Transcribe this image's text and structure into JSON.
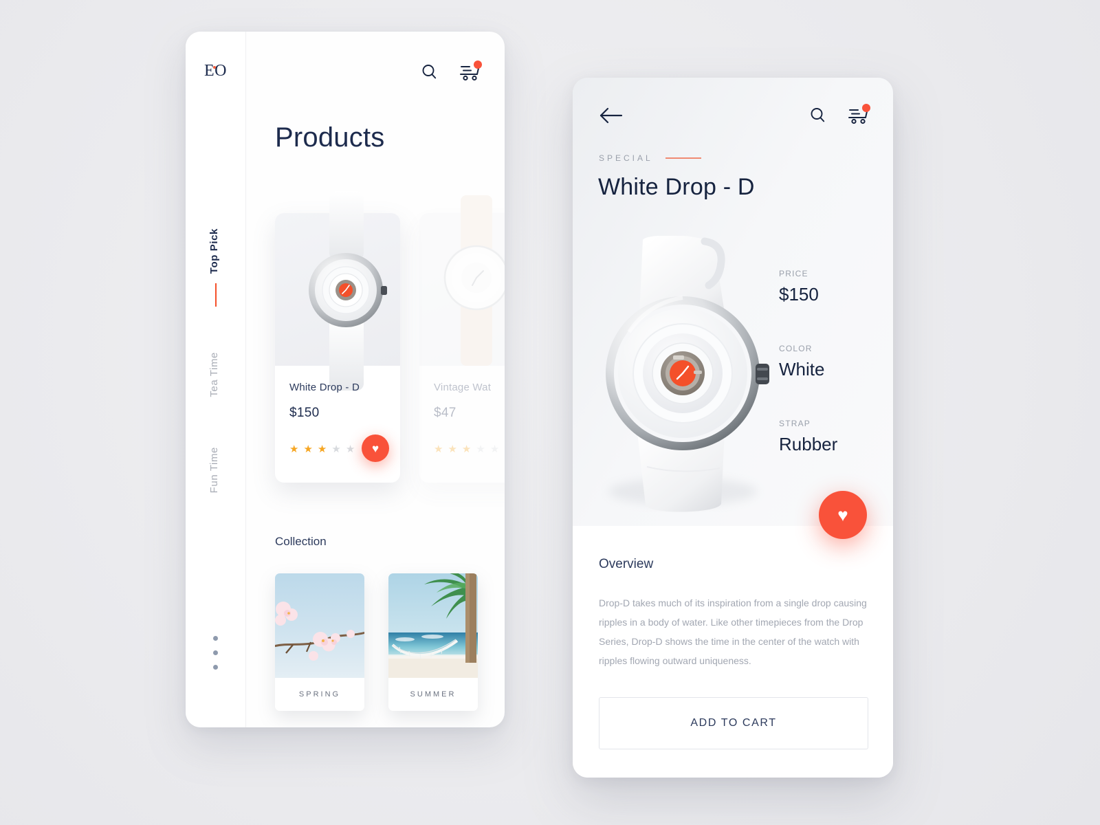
{
  "colors": {
    "accent": "#f9523a",
    "accent_line": "#f4502a",
    "ink": "#1d2b4d",
    "muted": "#a9adb6",
    "star": "#f6a623",
    "background": "#ececed"
  },
  "left_screen": {
    "logo": "EO",
    "icons": {
      "search": "search-icon",
      "cart": "cart-icon",
      "cart_badge": "•"
    },
    "page_title": "Products",
    "nav": [
      {
        "label": "Top Pick",
        "active": true
      },
      {
        "label": "Tea Time",
        "active": false
      },
      {
        "label": "Fun Time",
        "active": false
      }
    ],
    "products": [
      {
        "name": "White Drop - D",
        "price": "$150",
        "rating": 3,
        "rating_max": 5,
        "favorited": true,
        "image": "white-watch-ripple-dial"
      },
      {
        "name": "Vintage Wat",
        "price": "$47",
        "rating": 3,
        "rating_max": 5,
        "favorited": false,
        "image": "vintage-beige-strap-watch"
      }
    ],
    "collection": {
      "title": "Collection",
      "items": [
        {
          "label": "SPRING",
          "image": "cherry-blossom-branch"
        },
        {
          "label": "SUMMER",
          "image": "beach-hammock-palms"
        }
      ]
    },
    "pagination_dots": 3
  },
  "right_screen": {
    "icons": {
      "back": "back-arrow-icon",
      "search": "search-icon",
      "cart": "cart-icon",
      "cart_badge": "•"
    },
    "eyebrow": "SPECIAL",
    "title": "White Drop - D",
    "hero_image": "white-drop-d-watch-large",
    "specs": [
      {
        "key": "PRICE",
        "value": "$150"
      },
      {
        "key": "COLOR",
        "value": "White"
      },
      {
        "key": "STRAP",
        "value": "Rubber"
      }
    ],
    "favorite_button": "heart-icon",
    "overview": {
      "title": "Overview",
      "body": "Drop-D takes much of its inspiration from a single drop causing ripples in a body of water. Like other timepieces from the Drop Series, Drop-D shows the time in the center of the watch with ripples flowing outward uniqueness."
    },
    "add_to_cart_label": "ADD TO CART"
  },
  "glyphs": {
    "heart": "♥",
    "star": "★"
  }
}
